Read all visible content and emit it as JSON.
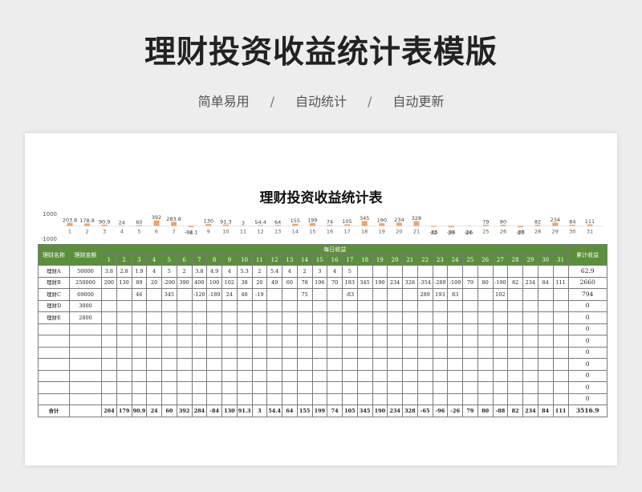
{
  "banner": {
    "title": "理财投资收益统计表模版",
    "subtitle": [
      "简单易用",
      "自动统计",
      "自动更新"
    ],
    "separator": "/"
  },
  "sheet": {
    "title": "理财投资收益统计表",
    "headers": {
      "name": "理财名称",
      "amount": "理财金额",
      "daily": "每日收益",
      "cumulative": "累计收益"
    },
    "days": [
      "1",
      "2",
      "3",
      "4",
      "5",
      "6",
      "7",
      "8",
      "9",
      "10",
      "11",
      "12",
      "13",
      "14",
      "15",
      "16",
      "17",
      "18",
      "19",
      "20",
      "21",
      "22",
      "23",
      "24",
      "25",
      "26",
      "27",
      "28",
      "29",
      "30",
      "31"
    ],
    "rows": [
      {
        "name": "理财A",
        "amount": "50000",
        "values": [
          "3.8",
          "2.8",
          "1.9",
          "4",
          "5",
          "2",
          "3.8",
          "4.9",
          "4",
          "5.3",
          "2",
          "5.4",
          "4",
          "2",
          "3",
          "4",
          "5",
          "",
          "",
          "",
          "",
          "",
          "",
          "",
          "",
          "",
          "",
          "",
          "",
          "",
          ""
        ],
        "cumulative": "62.9"
      },
      {
        "name": "理财B",
        "amount": "250000",
        "values": [
          "200",
          "130",
          "89",
          "20",
          "-290",
          "390",
          "400",
          "100",
          "102",
          "38",
          "20",
          "49",
          "60",
          "78",
          "196",
          "70",
          "183",
          "345",
          "190",
          "234",
          "328",
          "-354",
          "-289",
          "-109",
          "79",
          "80",
          "-190",
          "82",
          "234",
          "84",
          "111"
        ],
        "cumulative": "2660"
      },
      {
        "name": "理财C",
        "amount": "69000",
        "values": [
          "",
          "",
          "46",
          "",
          "345",
          "",
          "-120",
          "-189",
          "24",
          "48",
          "-19",
          "",
          "",
          "75",
          "",
          "",
          "-83",
          "",
          "",
          "",
          "",
          "289",
          "193",
          "83",
          "",
          "",
          "102",
          "",
          "",
          "",
          ""
        ],
        "cumulative": "794"
      },
      {
        "name": "理财D",
        "amount": "3000",
        "values": [
          "",
          "",
          "",
          "",
          "",
          "",
          "",
          "",
          "",
          "",
          "",
          "",
          "",
          "",
          "",
          "",
          "",
          "",
          "",
          "",
          "",
          "",
          "",
          "",
          "",
          "",
          "",
          "",
          "",
          "",
          ""
        ],
        "cumulative": "0"
      },
      {
        "name": "理财E",
        "amount": "2800",
        "values": [
          "",
          "",
          "",
          "",
          "",
          "",
          "",
          "",
          "",
          "",
          "",
          "",
          "",
          "",
          "",
          "",
          "",
          "",
          "",
          "",
          "",
          "",
          "",
          "",
          "",
          "",
          "",
          "",
          "",
          "",
          ""
        ],
        "cumulative": "0"
      },
      {
        "name": "",
        "amount": "",
        "values": [
          "",
          "",
          "",
          "",
          "",
          "",
          "",
          "",
          "",
          "",
          "",
          "",
          "",
          "",
          "",
          "",
          "",
          "",
          "",
          "",
          "",
          "",
          "",
          "",
          "",
          "",
          "",
          "",
          "",
          "",
          ""
        ],
        "cumulative": "0"
      },
      {
        "name": "",
        "amount": "",
        "values": [
          "",
          "",
          "",
          "",
          "",
          "",
          "",
          "",
          "",
          "",
          "",
          "",
          "",
          "",
          "",
          "",
          "",
          "",
          "",
          "",
          "",
          "",
          "",
          "",
          "",
          "",
          "",
          "",
          "",
          "",
          ""
        ],
        "cumulative": "0"
      },
      {
        "name": "",
        "amount": "",
        "values": [
          "",
          "",
          "",
          "",
          "",
          "",
          "",
          "",
          "",
          "",
          "",
          "",
          "",
          "",
          "",
          "",
          "",
          "",
          "",
          "",
          "",
          "",
          "",
          "",
          "",
          "",
          "",
          "",
          "",
          "",
          ""
        ],
        "cumulative": "0"
      },
      {
        "name": "",
        "amount": "",
        "values": [
          "",
          "",
          "",
          "",
          "",
          "",
          "",
          "",
          "",
          "",
          "",
          "",
          "",
          "",
          "",
          "",
          "",
          "",
          "",
          "",
          "",
          "",
          "",
          "",
          "",
          "",
          "",
          "",
          "",
          "",
          ""
        ],
        "cumulative": "0"
      },
      {
        "name": "",
        "amount": "",
        "values": [
          "",
          "",
          "",
          "",
          "",
          "",
          "",
          "",
          "",
          "",
          "",
          "",
          "",
          "",
          "",
          "",
          "",
          "",
          "",
          "",
          "",
          "",
          "",
          "",
          "",
          "",
          "",
          "",
          "",
          "",
          ""
        ],
        "cumulative": "0"
      },
      {
        "name": "",
        "amount": "",
        "values": [
          "",
          "",
          "",
          "",
          "",
          "",
          "",
          "",
          "",
          "",
          "",
          "",
          "",
          "",
          "",
          "",
          "",
          "",
          "",
          "",
          "",
          "",
          "",
          "",
          "",
          "",
          "",
          "",
          "",
          "",
          ""
        ],
        "cumulative": "0"
      },
      {
        "name": "",
        "amount": "",
        "values": [
          "",
          "",
          "",
          "",
          "",
          "",
          "",
          "",
          "",
          "",
          "",
          "",
          "",
          "",
          "",
          "",
          "",
          "",
          "",
          "",
          "",
          "",
          "",
          "",
          "",
          "",
          "",
          "",
          "",
          "",
          ""
        ],
        "cumulative": "0"
      }
    ],
    "total": {
      "label": "合计",
      "values": [
        "204",
        "179",
        "90.9",
        "24",
        "60",
        "392",
        "284",
        "-84",
        "130",
        "91.3",
        "3",
        "54.4",
        "64",
        "155",
        "199",
        "74",
        "105",
        "345",
        "190",
        "234",
        "328",
        "-65",
        "-96",
        "-26",
        "79",
        "80",
        "-88",
        "82",
        "234",
        "84",
        "111"
      ],
      "cumulative": "3516.9"
    }
  },
  "chart_data": {
    "type": "bar",
    "categories": [
      "1",
      "2",
      "3",
      "4",
      "5",
      "6",
      "7",
      "8",
      "9",
      "10",
      "11",
      "12",
      "13",
      "14",
      "15",
      "16",
      "17",
      "18",
      "19",
      "20",
      "21",
      "22",
      "23",
      "24",
      "25",
      "26",
      "27",
      "28",
      "29",
      "30",
      "31"
    ],
    "values": [
      203.8,
      178.8,
      90.9,
      24,
      60,
      392,
      283.8,
      -84.1,
      130,
      91.3,
      3,
      54.4,
      64,
      155,
      199,
      74,
      105,
      345,
      190,
      234,
      328,
      -65,
      -96,
      -26,
      79,
      80,
      -88,
      82,
      234,
      84,
      111
    ],
    "labels": [
      "203.8",
      "178.8",
      "90.9",
      "24",
      "60",
      "392",
      "283.8",
      "-84.1",
      "130",
      "91.3",
      "3",
      "54.4",
      "64",
      "155",
      "199",
      "74",
      "105",
      "345",
      "190",
      "234",
      "328",
      "-65",
      "-96",
      "-26",
      "79",
      "80",
      "-88",
      "82",
      "234",
      "84",
      "111"
    ],
    "ylim": [
      -1000,
      1000
    ],
    "yticks": [
      "1000",
      "-1000"
    ],
    "color": "#f0a46a",
    "title": "",
    "xlabel": "",
    "ylabel": ""
  }
}
